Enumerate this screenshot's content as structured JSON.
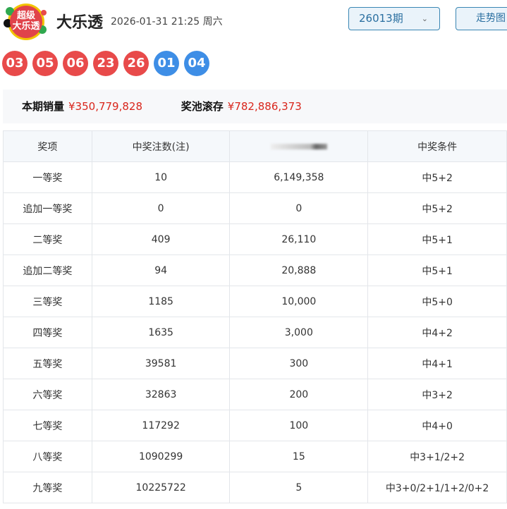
{
  "header": {
    "logo_text": "超级大乐透",
    "title": "大乐透",
    "datetime": "2026-01-31 21:25 周六",
    "issue_select": "26013期",
    "trend_button": "走势图"
  },
  "balls": {
    "red": [
      "03",
      "05",
      "06",
      "23",
      "26"
    ],
    "blue": [
      "01",
      "04"
    ]
  },
  "colors": {
    "red_ball": "#e84a4a",
    "blue_ball": "#3e8ee6",
    "amount": "#d9261c"
  },
  "summary": {
    "sales_label": "本期销量",
    "sales_value": "¥350,779,828",
    "pool_label": "奖池滚存",
    "pool_value": "¥782,886,373"
  },
  "table": {
    "headers": [
      "奖项",
      "中奖注数(注)",
      "",
      "中奖条件"
    ],
    "rows": [
      [
        "一等奖",
        "10",
        "6,149,358",
        "中5+2"
      ],
      [
        "追加一等奖",
        "0",
        "0",
        "中5+2"
      ],
      [
        "二等奖",
        "409",
        "26,110",
        "中5+1"
      ],
      [
        "追加二等奖",
        "94",
        "20,888",
        "中5+1"
      ],
      [
        "三等奖",
        "1185",
        "10,000",
        "中5+0"
      ],
      [
        "四等奖",
        "1635",
        "3,000",
        "中4+2"
      ],
      [
        "五等奖",
        "39581",
        "300",
        "中4+1"
      ],
      [
        "六等奖",
        "32863",
        "200",
        "中3+2"
      ],
      [
        "七等奖",
        "117292",
        "100",
        "中4+0"
      ],
      [
        "八等奖",
        "1090299",
        "15",
        "中3+1/2+2"
      ],
      [
        "九等奖",
        "10225722",
        "5",
        "中3+0/2+1/1+2/0+2"
      ]
    ]
  }
}
